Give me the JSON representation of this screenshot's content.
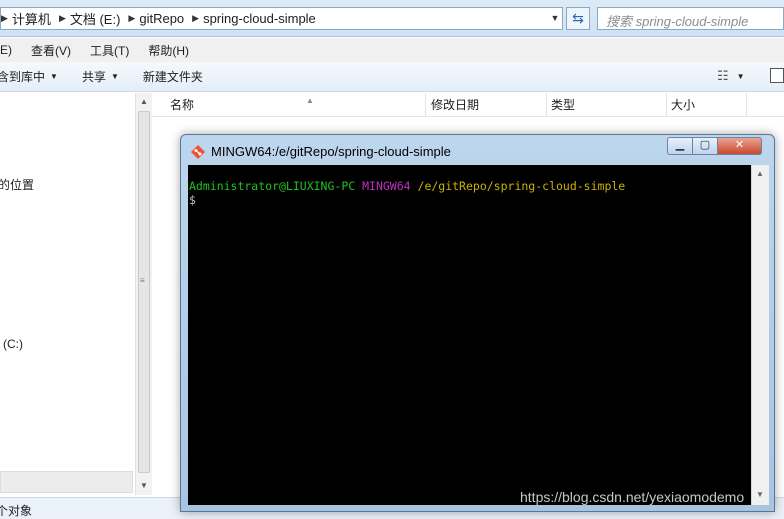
{
  "address_bar": {
    "segments": [
      "计算机",
      "文档 (E:)",
      "gitRepo",
      "spring-cloud-simple"
    ],
    "separator": "▶",
    "search_placeholder": "搜索 spring-cloud-simple"
  },
  "menu": [
    "(E)",
    "查看(V)",
    "工具(T)",
    "帮助(H)"
  ],
  "toolbar": {
    "include_library": "含到库中",
    "share": "共享",
    "new_folder": "新建文件夹"
  },
  "nav_pane": {
    "items": [
      "的位置",
      "(C:)"
    ]
  },
  "columns": [
    "名称",
    "修改日期",
    "类型",
    "大小"
  ],
  "status_bar": {
    "text": "个对象"
  },
  "terminal": {
    "title": "MINGW64:/e/gitRepo/spring-cloud-simple",
    "prompt_user": "Administrator@LIUXING-PC",
    "prompt_host": "MINGW64",
    "prompt_path": "/e/gitRepo/spring-cloud-simple",
    "cursor_line": "$"
  },
  "watermark": "https://blog.csdn.net/yexiaomodemo",
  "colors": {
    "terminal_bg": "#000000",
    "prompt_user": "#20c020",
    "prompt_host": "#c030c0",
    "prompt_path": "#c8b400"
  }
}
